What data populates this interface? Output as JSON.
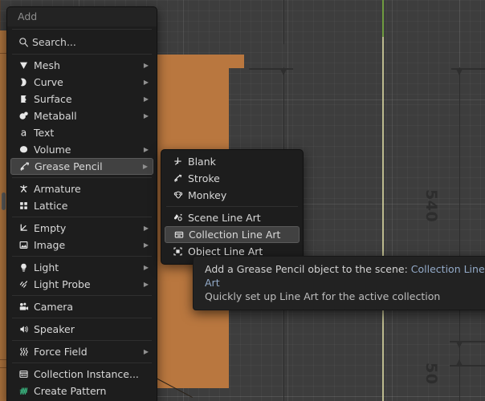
{
  "viewport": {
    "name": "3d-viewport",
    "background_color": "#3d3d3d",
    "selected_object_color": "#b9773f",
    "axis_green_color": "#6f9b3f",
    "axis_cream_color": "#d8d5a0",
    "annotations": [
      {
        "text": "540",
        "rotated": true
      },
      {
        "text": "50",
        "rotated": true
      }
    ]
  },
  "add_menu": {
    "title": "Add",
    "search": {
      "placeholder": "Search...",
      "icon": "search-icon"
    },
    "groups": [
      {
        "items": [
          {
            "label": "Mesh",
            "icon": "mesh-icon",
            "submenu": true,
            "selected": false
          },
          {
            "label": "Curve",
            "icon": "curve-icon",
            "submenu": true,
            "selected": false
          },
          {
            "label": "Surface",
            "icon": "surface-icon",
            "submenu": true,
            "selected": false
          },
          {
            "label": "Metaball",
            "icon": "metaball-icon",
            "submenu": true,
            "selected": false
          },
          {
            "label": "Text",
            "icon": "text-icon",
            "submenu": false,
            "selected": false
          },
          {
            "label": "Volume",
            "icon": "volume-icon",
            "submenu": true,
            "selected": false
          },
          {
            "label": "Grease Pencil",
            "icon": "grease-pencil-icon",
            "submenu": true,
            "selected": true
          }
        ]
      },
      {
        "items": [
          {
            "label": "Armature",
            "icon": "armature-icon",
            "submenu": false,
            "selected": false
          },
          {
            "label": "Lattice",
            "icon": "lattice-icon",
            "submenu": false,
            "selected": false
          }
        ]
      },
      {
        "items": [
          {
            "label": "Empty",
            "icon": "empty-icon",
            "submenu": true,
            "selected": false
          },
          {
            "label": "Image",
            "icon": "image-icon",
            "submenu": true,
            "selected": false
          }
        ]
      },
      {
        "items": [
          {
            "label": "Light",
            "icon": "light-icon",
            "submenu": true,
            "selected": false
          },
          {
            "label": "Light Probe",
            "icon": "light-probe-icon",
            "submenu": true,
            "selected": false
          }
        ]
      },
      {
        "items": [
          {
            "label": "Camera",
            "icon": "camera-icon",
            "submenu": false,
            "selected": false
          }
        ]
      },
      {
        "items": [
          {
            "label": "Speaker",
            "icon": "speaker-icon",
            "submenu": false,
            "selected": false
          }
        ]
      },
      {
        "items": [
          {
            "label": "Force Field",
            "icon": "force-field-icon",
            "submenu": true,
            "selected": false
          }
        ]
      },
      {
        "items": [
          {
            "label": "Collection Instance...",
            "icon": "collection-instance-icon",
            "submenu": false,
            "selected": false
          },
          {
            "label": "Create Pattern",
            "icon": "create-pattern-icon",
            "submenu": false,
            "selected": false,
            "accent": "#3ec98d"
          }
        ]
      }
    ]
  },
  "grease_pencil_submenu": {
    "groups": [
      {
        "items": [
          {
            "label": "Blank",
            "icon": "blank-icon",
            "selected": false
          },
          {
            "label": "Stroke",
            "icon": "stroke-icon",
            "selected": false
          },
          {
            "label": "Monkey",
            "icon": "monkey-icon",
            "selected": false
          }
        ]
      },
      {
        "items": [
          {
            "label": "Scene Line Art",
            "icon": "scene-line-art-icon",
            "selected": false
          },
          {
            "label": "Collection Line Art",
            "icon": "collection-line-art-icon",
            "selected": true
          },
          {
            "label": "Object Line Art",
            "icon": "object-line-art-icon",
            "selected": false,
            "occluded": true
          }
        ]
      }
    ]
  },
  "tooltip": {
    "line1_prefix": "Add a Grease Pencil object to the scene:",
    "line1_value": "Collection Line Art",
    "line2": "Quickly set up Line Art for the active collection",
    "value_color": "#93aac8"
  }
}
